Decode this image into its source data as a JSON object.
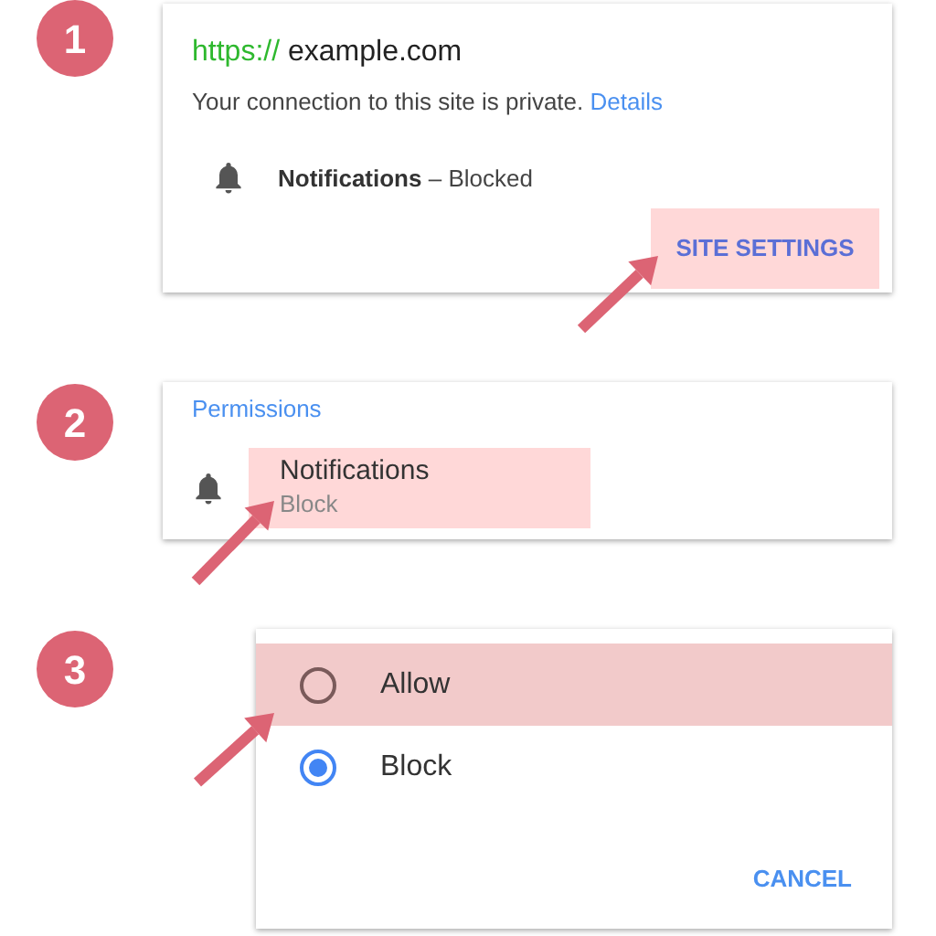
{
  "steps": [
    {
      "number": "1",
      "kind": "site_info",
      "scheme": "https://",
      "host": "example.com",
      "message": "Your connection to this site is private.",
      "link": "Details",
      "permission": {
        "name": "Notifications",
        "separator": "–",
        "status": "Blocked"
      },
      "button": {
        "label": "SITE SETTINGS",
        "highlighted": true
      }
    },
    {
      "number": "2",
      "kind": "permissions",
      "heading": "Permissions",
      "item": {
        "name": "Notifications",
        "value": "Block",
        "highlighted": true
      }
    },
    {
      "number": "3",
      "kind": "choice",
      "options": [
        {
          "label": "Allow",
          "selected": false,
          "highlighted": true
        },
        {
          "label": "Block",
          "selected": true,
          "highlighted": false
        }
      ],
      "button": "CANCEL"
    }
  ]
}
